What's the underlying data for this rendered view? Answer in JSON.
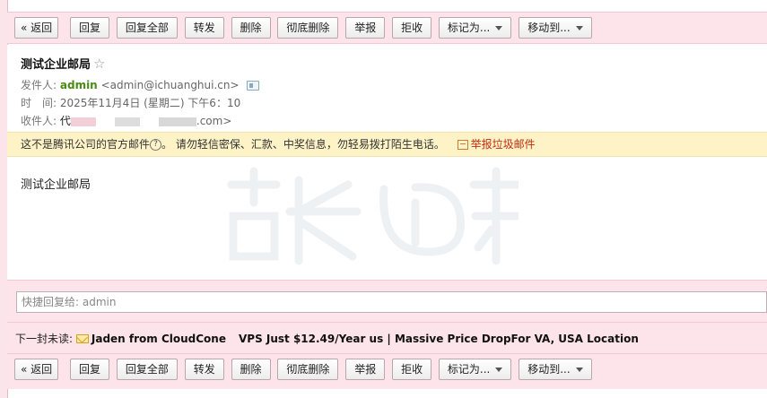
{
  "toolbar": {
    "back": "« 返回",
    "reply": "回复",
    "reply_all": "回复全部",
    "forward": "转发",
    "delete": "删除",
    "delete_permanent": "彻底删除",
    "report": "举报",
    "reject": "拒收",
    "mark_as": "标记为...",
    "move_to": "移动到..."
  },
  "email": {
    "subject": "测试企业邮局",
    "star": "☆",
    "sender_label": "发件人:",
    "sender_name": "admin",
    "sender_email": "<admin@ichuanghui.cn>",
    "time_label": "时　间:",
    "time_value": "2025年11月4日 (星期二) 下午6：10",
    "recipient_label": "收件人:",
    "recipient_prefix": "代",
    "recipient_suffix": ".com>",
    "body": "测试企业邮局"
  },
  "notice": {
    "text_a": "这不是腾讯公司的官方邮件",
    "question": "?",
    "text_b": "。 请勿轻信密保、汇款、中奖信息，勿轻易拨打陌生电话。",
    "report_spam": "举报垃圾邮件"
  },
  "quick_reply": {
    "placeholder": "快捷回复给: admin"
  },
  "next_unread": {
    "label": "下一封未读:",
    "sender": "Jaden from CloudCone",
    "subject": "VPS Just $12.49/Year us | Massive Price DropFor VA, USA Location"
  },
  "colors": {
    "toolbar_bg": "#fde3ea",
    "sender_green": "#4a8b13",
    "notice_bg": "#fdf3c6",
    "report_red": "#c52b13"
  }
}
